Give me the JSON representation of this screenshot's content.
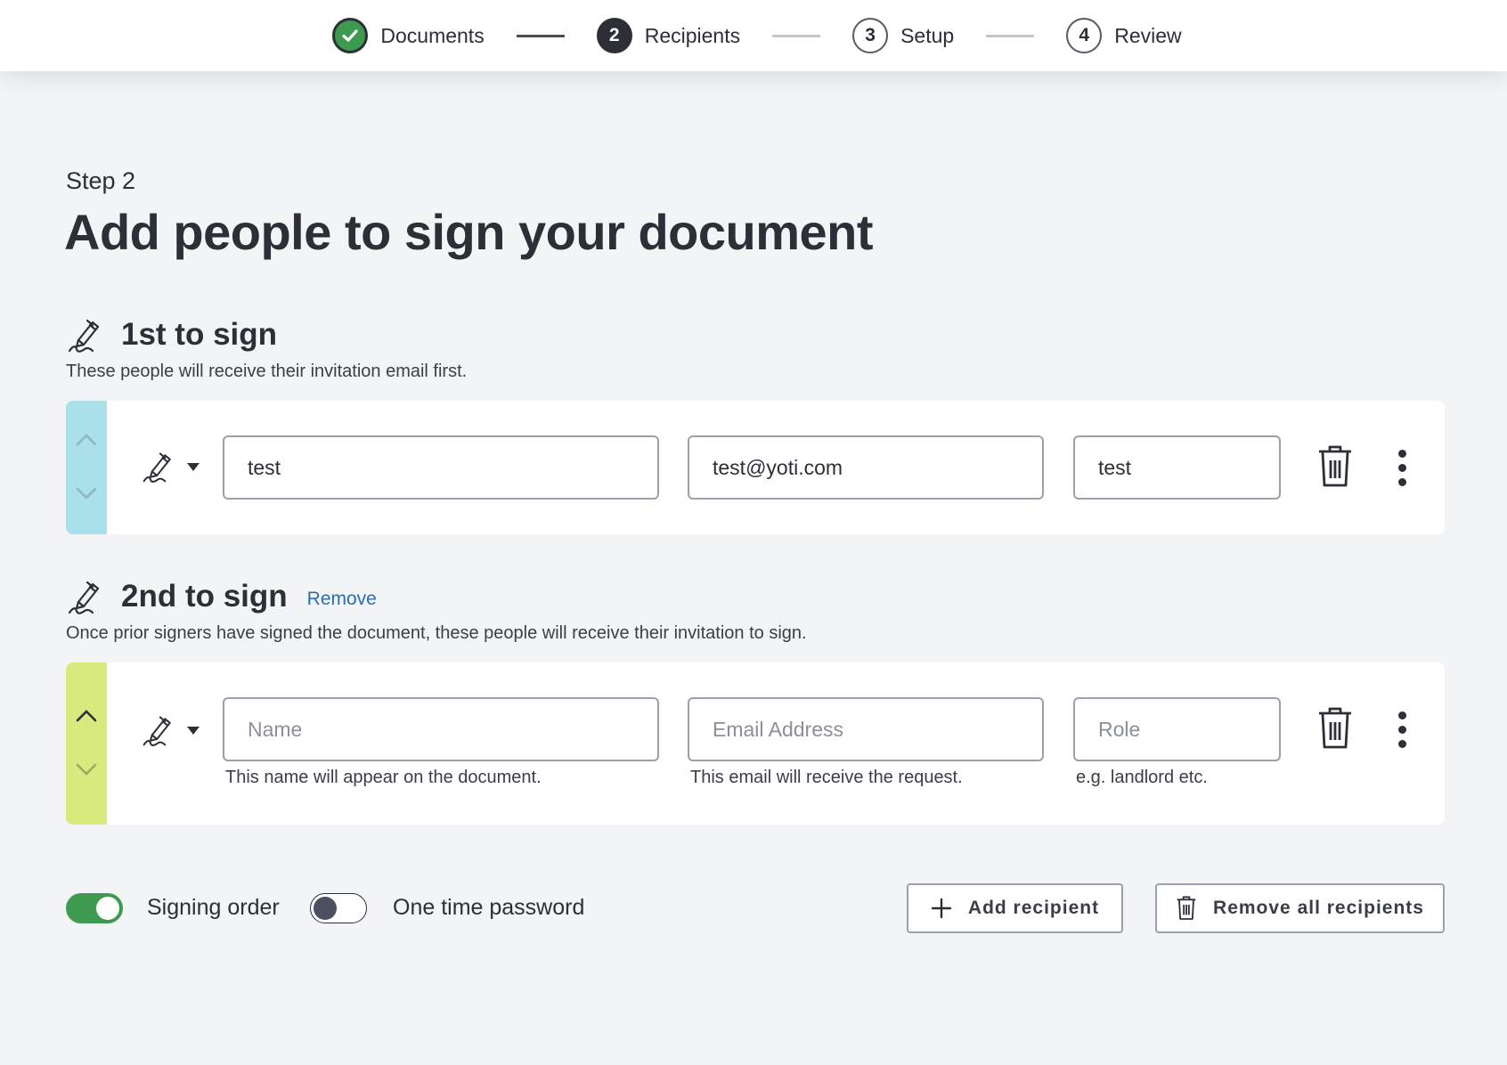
{
  "stepper": {
    "steps": [
      {
        "number": "",
        "label": "Documents",
        "state": "done"
      },
      {
        "number": "2",
        "label": "Recipients",
        "state": "active"
      },
      {
        "number": "3",
        "label": "Setup",
        "state": "todo"
      },
      {
        "number": "4",
        "label": "Review",
        "state": "todo"
      }
    ]
  },
  "page": {
    "step_label": "Step 2",
    "title": "Add people to sign your document"
  },
  "groups": [
    {
      "title": "1st to sign",
      "description": "These people will receive their invitation email first.",
      "strip_color": "#a9e0ea",
      "recipient": {
        "name_value": "test",
        "email_value": "test@yoti.com",
        "role_value": "test",
        "name_placeholder": "Name",
        "email_placeholder": "Email Address",
        "role_placeholder": "Role"
      }
    },
    {
      "title": "2nd to sign",
      "remove_label": "Remove",
      "description": "Once prior signers have signed the document, these people will receive their invitation to sign.",
      "strip_color": "#d8ea7e",
      "recipient": {
        "name_value": "",
        "email_value": "",
        "role_value": "",
        "name_placeholder": "Name",
        "email_placeholder": "Email Address",
        "role_placeholder": "Role",
        "name_hint": "This name will appear on the document.",
        "email_hint": "This email will receive the request.",
        "role_hint": "e.g. landlord etc."
      }
    }
  ],
  "options": {
    "signing_order_label": "Signing order",
    "signing_order_on": true,
    "otp_label": "One time password",
    "otp_on": false
  },
  "actions": {
    "add_recipient": "Add recipient",
    "remove_all": "Remove all recipients"
  },
  "colors": {
    "accent_green": "#3d9a4f",
    "link_blue": "#2d6cb5"
  }
}
